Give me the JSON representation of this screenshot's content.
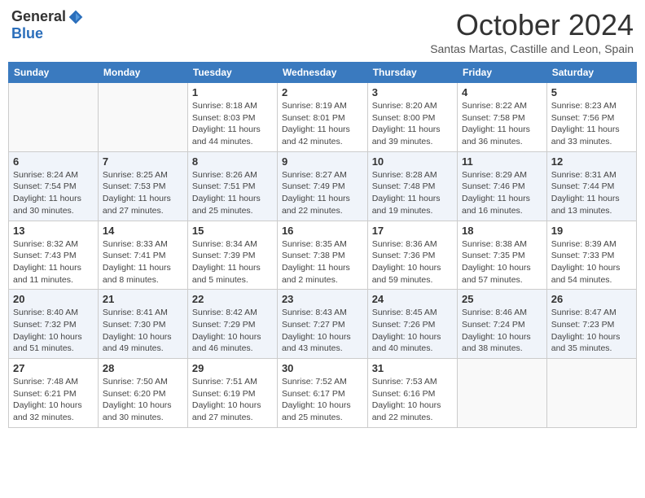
{
  "logo": {
    "general": "General",
    "blue": "Blue"
  },
  "title": "October 2024",
  "subtitle": "Santas Martas, Castille and Leon, Spain",
  "weekdays": [
    "Sunday",
    "Monday",
    "Tuesday",
    "Wednesday",
    "Thursday",
    "Friday",
    "Saturday"
  ],
  "weeks": [
    [
      {
        "day": "",
        "info": ""
      },
      {
        "day": "",
        "info": ""
      },
      {
        "day": "1",
        "info": "Sunrise: 8:18 AM\nSunset: 8:03 PM\nDaylight: 11 hours and 44 minutes."
      },
      {
        "day": "2",
        "info": "Sunrise: 8:19 AM\nSunset: 8:01 PM\nDaylight: 11 hours and 42 minutes."
      },
      {
        "day": "3",
        "info": "Sunrise: 8:20 AM\nSunset: 8:00 PM\nDaylight: 11 hours and 39 minutes."
      },
      {
        "day": "4",
        "info": "Sunrise: 8:22 AM\nSunset: 7:58 PM\nDaylight: 11 hours and 36 minutes."
      },
      {
        "day": "5",
        "info": "Sunrise: 8:23 AM\nSunset: 7:56 PM\nDaylight: 11 hours and 33 minutes."
      }
    ],
    [
      {
        "day": "6",
        "info": "Sunrise: 8:24 AM\nSunset: 7:54 PM\nDaylight: 11 hours and 30 minutes."
      },
      {
        "day": "7",
        "info": "Sunrise: 8:25 AM\nSunset: 7:53 PM\nDaylight: 11 hours and 27 minutes."
      },
      {
        "day": "8",
        "info": "Sunrise: 8:26 AM\nSunset: 7:51 PM\nDaylight: 11 hours and 25 minutes."
      },
      {
        "day": "9",
        "info": "Sunrise: 8:27 AM\nSunset: 7:49 PM\nDaylight: 11 hours and 22 minutes."
      },
      {
        "day": "10",
        "info": "Sunrise: 8:28 AM\nSunset: 7:48 PM\nDaylight: 11 hours and 19 minutes."
      },
      {
        "day": "11",
        "info": "Sunrise: 8:29 AM\nSunset: 7:46 PM\nDaylight: 11 hours and 16 minutes."
      },
      {
        "day": "12",
        "info": "Sunrise: 8:31 AM\nSunset: 7:44 PM\nDaylight: 11 hours and 13 minutes."
      }
    ],
    [
      {
        "day": "13",
        "info": "Sunrise: 8:32 AM\nSunset: 7:43 PM\nDaylight: 11 hours and 11 minutes."
      },
      {
        "day": "14",
        "info": "Sunrise: 8:33 AM\nSunset: 7:41 PM\nDaylight: 11 hours and 8 minutes."
      },
      {
        "day": "15",
        "info": "Sunrise: 8:34 AM\nSunset: 7:39 PM\nDaylight: 11 hours and 5 minutes."
      },
      {
        "day": "16",
        "info": "Sunrise: 8:35 AM\nSunset: 7:38 PM\nDaylight: 11 hours and 2 minutes."
      },
      {
        "day": "17",
        "info": "Sunrise: 8:36 AM\nSunset: 7:36 PM\nDaylight: 10 hours and 59 minutes."
      },
      {
        "day": "18",
        "info": "Sunrise: 8:38 AM\nSunset: 7:35 PM\nDaylight: 10 hours and 57 minutes."
      },
      {
        "day": "19",
        "info": "Sunrise: 8:39 AM\nSunset: 7:33 PM\nDaylight: 10 hours and 54 minutes."
      }
    ],
    [
      {
        "day": "20",
        "info": "Sunrise: 8:40 AM\nSunset: 7:32 PM\nDaylight: 10 hours and 51 minutes."
      },
      {
        "day": "21",
        "info": "Sunrise: 8:41 AM\nSunset: 7:30 PM\nDaylight: 10 hours and 49 minutes."
      },
      {
        "day": "22",
        "info": "Sunrise: 8:42 AM\nSunset: 7:29 PM\nDaylight: 10 hours and 46 minutes."
      },
      {
        "day": "23",
        "info": "Sunrise: 8:43 AM\nSunset: 7:27 PM\nDaylight: 10 hours and 43 minutes."
      },
      {
        "day": "24",
        "info": "Sunrise: 8:45 AM\nSunset: 7:26 PM\nDaylight: 10 hours and 40 minutes."
      },
      {
        "day": "25",
        "info": "Sunrise: 8:46 AM\nSunset: 7:24 PM\nDaylight: 10 hours and 38 minutes."
      },
      {
        "day": "26",
        "info": "Sunrise: 8:47 AM\nSunset: 7:23 PM\nDaylight: 10 hours and 35 minutes."
      }
    ],
    [
      {
        "day": "27",
        "info": "Sunrise: 7:48 AM\nSunset: 6:21 PM\nDaylight: 10 hours and 32 minutes."
      },
      {
        "day": "28",
        "info": "Sunrise: 7:50 AM\nSunset: 6:20 PM\nDaylight: 10 hours and 30 minutes."
      },
      {
        "day": "29",
        "info": "Sunrise: 7:51 AM\nSunset: 6:19 PM\nDaylight: 10 hours and 27 minutes."
      },
      {
        "day": "30",
        "info": "Sunrise: 7:52 AM\nSunset: 6:17 PM\nDaylight: 10 hours and 25 minutes."
      },
      {
        "day": "31",
        "info": "Sunrise: 7:53 AM\nSunset: 6:16 PM\nDaylight: 10 hours and 22 minutes."
      },
      {
        "day": "",
        "info": ""
      },
      {
        "day": "",
        "info": ""
      }
    ]
  ]
}
